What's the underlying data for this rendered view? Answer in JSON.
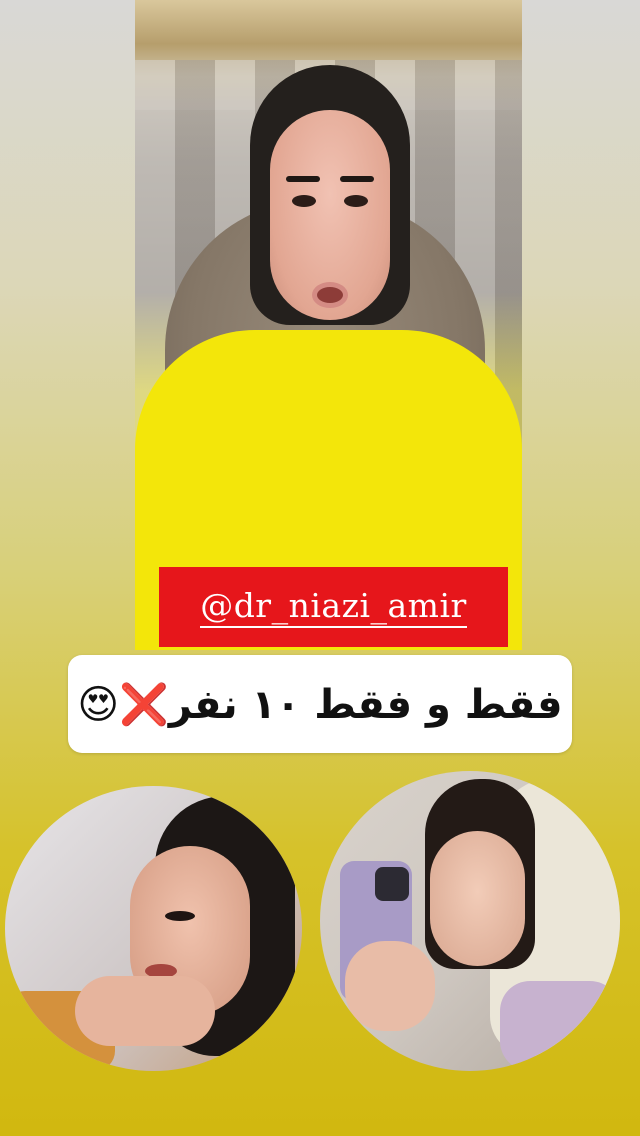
{
  "story": {
    "handle": "@dr_niazi_amir",
    "caption": "فقط و فقط ۱۰ نفر❌😍"
  },
  "images": {
    "main_video": "woman-in-scarf-speaking",
    "before_photo": "profile-portrait-before",
    "after_photo": "mirror-selfie-after"
  },
  "colors": {
    "handle_bg": "#e6161b",
    "caption_bg": "#ffffff",
    "background_top": "#d9d8d6",
    "background_bottom": "#d1b80f"
  }
}
